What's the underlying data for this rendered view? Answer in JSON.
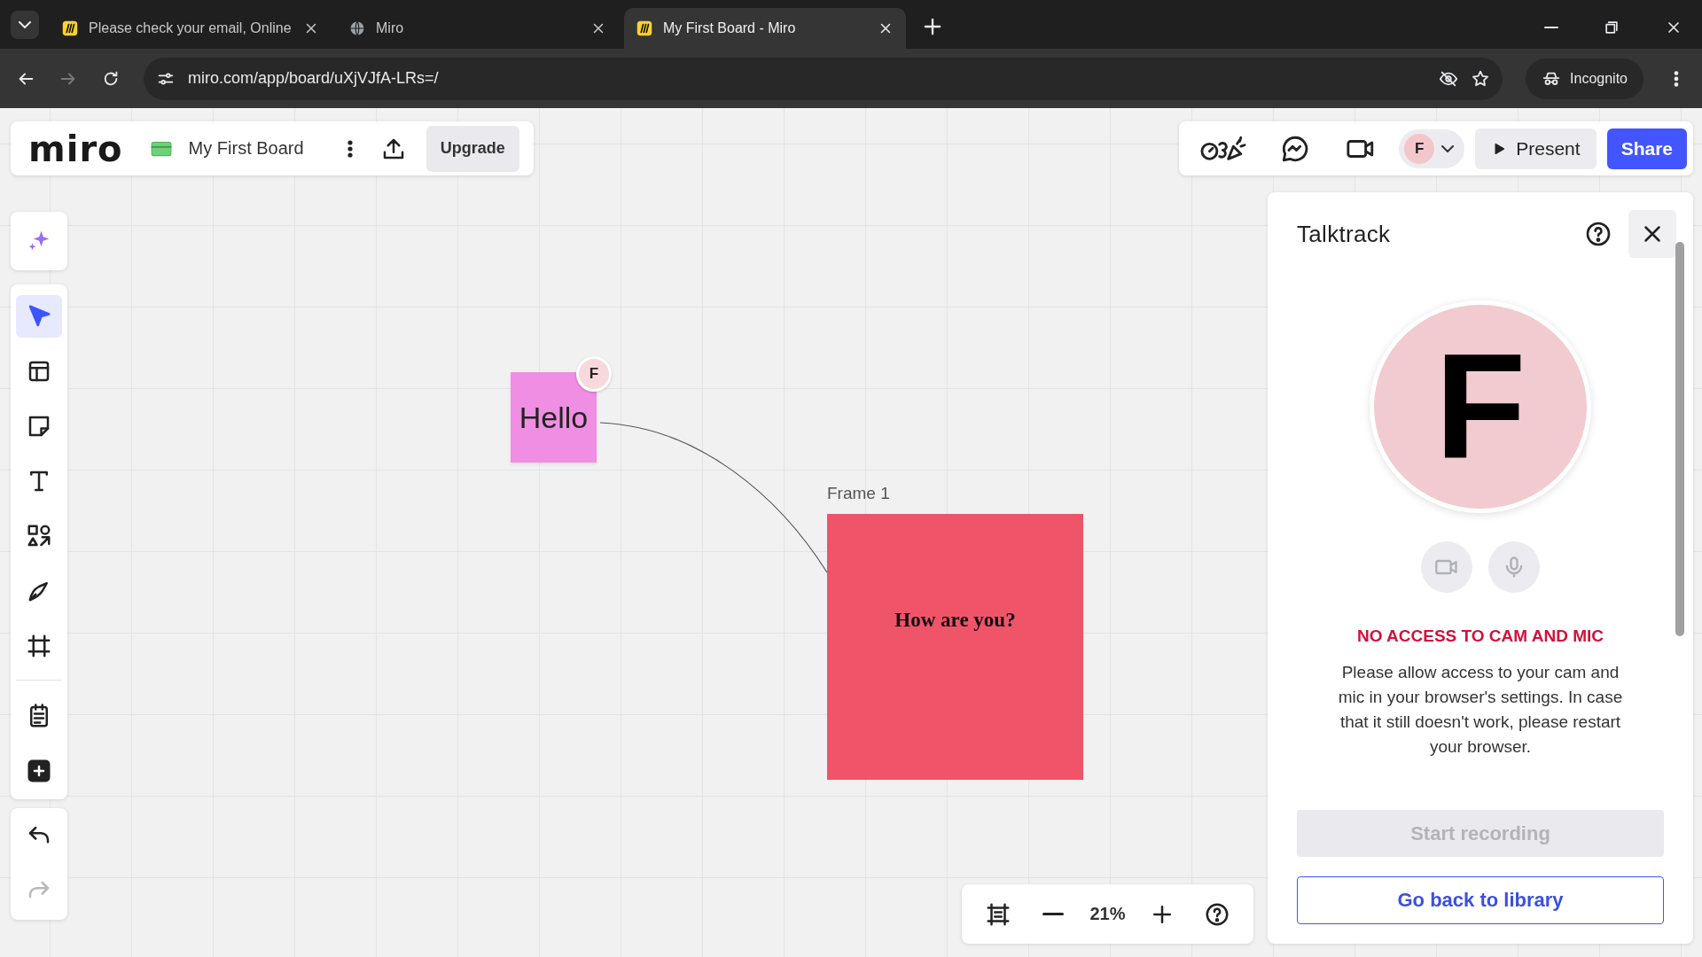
{
  "browser": {
    "tabs": [
      {
        "title": "Please check your email, Online",
        "kind": "miro",
        "selected": false
      },
      {
        "title": "Miro",
        "kind": "globe",
        "selected": false
      },
      {
        "title": "My First Board - Miro",
        "kind": "miro",
        "selected": true
      }
    ],
    "url": "miro.com/app/board/uXjVJfA-LRs=/",
    "profile": "Incognito"
  },
  "board_header": {
    "logo": "miro",
    "board_name": "My First Board",
    "upgrade": "Upgrade"
  },
  "collab_bar": {
    "avatar": "F",
    "present": "Present",
    "share": "Share"
  },
  "tool_groups": [
    {
      "sections": [
        [
          {
            "kind": "ai",
            "selected": false,
            "disabled": false
          }
        ]
      ]
    },
    {
      "sections": [
        [
          {
            "kind": "pointer",
            "selected": true,
            "disabled": false
          },
          {
            "kind": "template",
            "selected": false,
            "disabled": false
          },
          {
            "kind": "sticky",
            "selected": false,
            "disabled": false
          },
          {
            "kind": "text",
            "selected": false,
            "disabled": false
          },
          {
            "kind": "shapes",
            "selected": false,
            "disabled": false
          },
          {
            "kind": "pen",
            "selected": false,
            "disabled": false
          },
          {
            "kind": "frame",
            "selected": false,
            "disabled": false
          }
        ],
        [
          {
            "kind": "notes",
            "selected": false,
            "disabled": false
          },
          {
            "kind": "add",
            "selected": false,
            "disabled": false
          }
        ]
      ]
    },
    {
      "sections": [
        [
          {
            "kind": "undo",
            "selected": false,
            "disabled": false
          },
          {
            "kind": "redo",
            "selected": false,
            "disabled": true
          }
        ]
      ]
    }
  ],
  "canvas": {
    "sticky_note": {
      "text": "Hello",
      "avatar": "F"
    },
    "frame": {
      "label": "Frame 1",
      "text": "How are you?"
    }
  },
  "talktrack": {
    "title": "Talktrack",
    "avatar": "F",
    "error": "NO ACCESS TO CAM AND MIC",
    "message": "Please allow access to your cam and mic in your browser's settings. In case that it still doesn't work, please restart your browser.",
    "start_button": {
      "label": "Start recording",
      "disabled": true
    },
    "back_button": {
      "label": "Go back to library"
    }
  },
  "zoom": {
    "value": "21%"
  }
}
